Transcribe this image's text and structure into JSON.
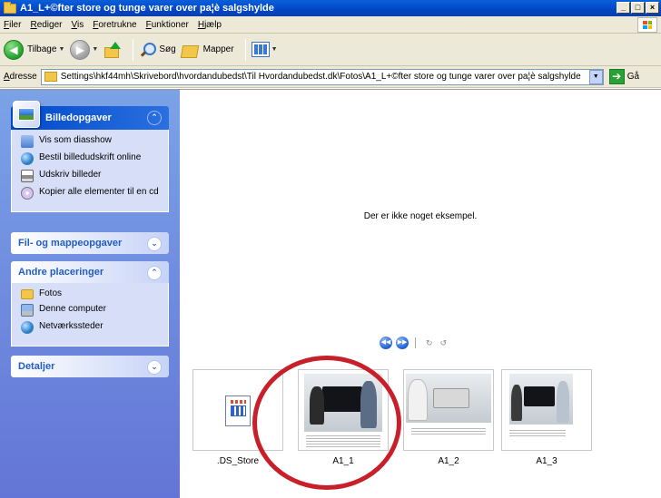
{
  "window": {
    "title": "A1_L+©fter store og tunge varer over pa¦è salgshylde",
    "controls": [
      "_",
      "□",
      "×"
    ]
  },
  "menubar": {
    "items": [
      "Filer",
      "Rediger",
      "Vis",
      "Foretrukne",
      "Funktioner",
      "Hjælp"
    ]
  },
  "toolbar": {
    "back_label": "Tilbage",
    "search_label": "Søg",
    "folders_label": "Mapper"
  },
  "addressbar": {
    "label": "Adresse",
    "path": "Settings\\hkf44mh\\Skrivebord\\hvordandubedst\\Til Hvordandubedst.dk\\Fotos\\A1_L+©fter store og tunge varer over pa¦è salgshylde",
    "go_label": "Gå"
  },
  "taskpane": {
    "picture_tasks": {
      "title": "Billedopgaver",
      "items": [
        {
          "label": "Vis som diasshow",
          "icon": "slideshow-icon"
        },
        {
          "label": "Bestil billedudskrift online",
          "icon": "globe-icon"
        },
        {
          "label": "Udskriv billeder",
          "icon": "printer-icon"
        },
        {
          "label": "Kopier alle elementer til en cd",
          "icon": "cd-icon"
        }
      ]
    },
    "file_tasks": {
      "title": "Fil- og mappeopgaver"
    },
    "other_places": {
      "title": "Andre placeringer",
      "items": [
        {
          "label": "Fotos",
          "icon": "folder-icon"
        },
        {
          "label": "Denne computer",
          "icon": "computer-icon"
        },
        {
          "label": "Netværkssteder",
          "icon": "network-icon"
        }
      ]
    },
    "details": {
      "title": "Detaljer"
    }
  },
  "preview": {
    "message": "Der er ikke noget eksempel."
  },
  "files": [
    {
      "name": ".DS_Store",
      "type": "file"
    },
    {
      "name": "A1_1",
      "type": "image"
    },
    {
      "name": "A1_2",
      "type": "image"
    },
    {
      "name": "A1_3",
      "type": "image"
    }
  ],
  "colors": {
    "titlebar": "#0046c8",
    "taskpane": "#6375d6",
    "annotation": "#c8202a"
  }
}
